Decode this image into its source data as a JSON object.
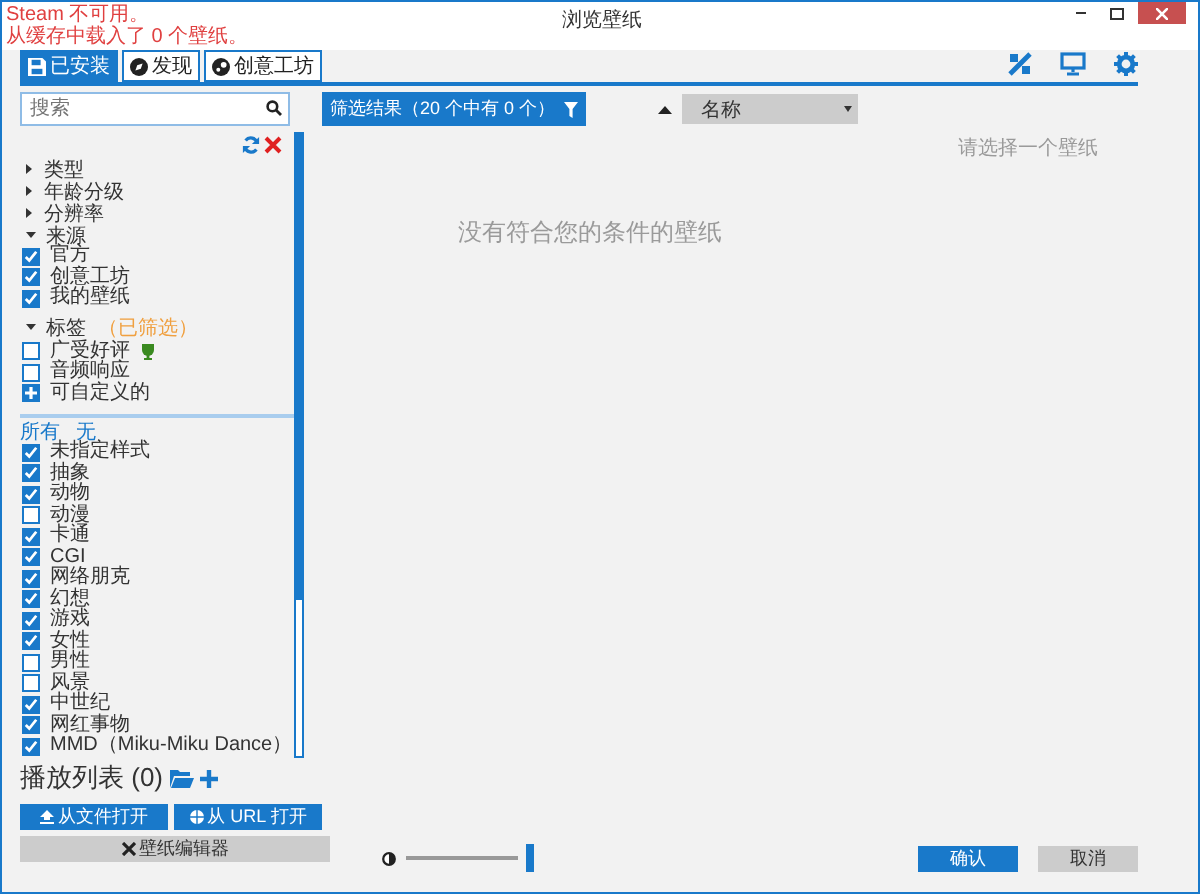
{
  "window": {
    "title": "浏览壁纸",
    "warning": [
      "Steam 不可用。",
      "从缓存中载入了 0 个壁纸。"
    ]
  },
  "tabs": [
    {
      "label": "已安装",
      "selected": true
    },
    {
      "label": "发现",
      "selected": false
    },
    {
      "label": "创意工坊",
      "selected": false
    }
  ],
  "search": {
    "placeholder": "搜索"
  },
  "filter_button": "筛选结果（20 个中有 0 个）",
  "sort": {
    "value": "名称"
  },
  "sidebar": {
    "sections": [
      {
        "label": "类型",
        "expanded": false
      },
      {
        "label": "年龄分级",
        "expanded": false
      },
      {
        "label": "分辨率",
        "expanded": false
      },
      {
        "label": "来源",
        "expanded": true,
        "options": [
          {
            "label": "官方",
            "kind": "check",
            "checked": true
          },
          {
            "label": "创意工坊",
            "kind": "check",
            "checked": true
          },
          {
            "label": "我的壁纸",
            "kind": "check",
            "checked": true
          }
        ]
      },
      {
        "label": "标签",
        "note": "（已筛选）",
        "expanded": true,
        "options": [
          {
            "label": "广受好评",
            "kind": "award",
            "checked": false
          },
          {
            "label": "音频响应",
            "kind": "check",
            "checked": false
          },
          {
            "label": "可自定义的",
            "kind": "plus"
          }
        ]
      }
    ],
    "tag_links": [
      "所有",
      "无"
    ],
    "tags": [
      {
        "label": "未指定样式",
        "checked": true
      },
      {
        "label": "抽象",
        "checked": true
      },
      {
        "label": "动物",
        "checked": true
      },
      {
        "label": "动漫",
        "checked": false
      },
      {
        "label": "卡通",
        "checked": true
      },
      {
        "label": "CGI",
        "checked": true
      },
      {
        "label": "网络朋克",
        "checked": true
      },
      {
        "label": "幻想",
        "checked": true
      },
      {
        "label": "游戏",
        "checked": true
      },
      {
        "label": "女性",
        "checked": true
      },
      {
        "label": "男性",
        "checked": false
      },
      {
        "label": "风景",
        "checked": false
      },
      {
        "label": "中世纪",
        "checked": true
      },
      {
        "label": "网红事物",
        "checked": true
      },
      {
        "label": "MMD（Miku-Miku Dance）",
        "checked": true
      }
    ]
  },
  "playlist": {
    "title": "播放列表",
    "count": "(0)"
  },
  "open_buttons": [
    {
      "label": "从文件打开"
    },
    {
      "label": "从 URL 打开"
    }
  ],
  "editor_button": "壁纸编辑器",
  "brightness": {
    "level": 1
  },
  "empty_message": "没有符合您的条件的壁纸",
  "details_hint": "请选择一个壁纸",
  "dialog_buttons": [
    {
      "label": "确认",
      "primary": true
    },
    {
      "label": "取消",
      "primary": false
    }
  ]
}
